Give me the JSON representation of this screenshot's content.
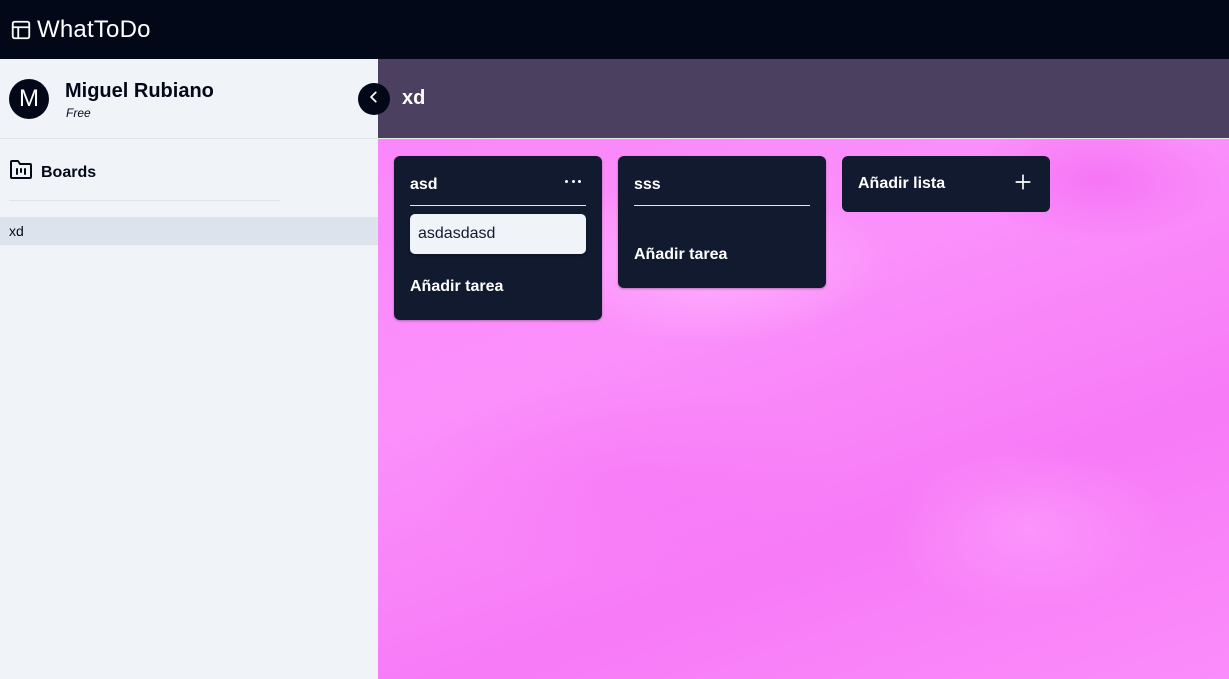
{
  "app": {
    "title": "WhatToDo",
    "logo_icon": "table-layout-icon"
  },
  "user": {
    "initial": "M",
    "name": "Miguel Rubiano",
    "plan": "Free"
  },
  "sidebar": {
    "boards_label": "Boards",
    "boards_icon": "folder-kanban-icon",
    "boards": [
      {
        "label": "xd",
        "selected": true
      }
    ]
  },
  "board": {
    "title": "xd",
    "header_color": "#4b4060",
    "background_color": "#fa85fa",
    "lists": [
      {
        "title": "asd",
        "has_menu": true,
        "tasks": [
          "asdasdasd"
        ],
        "add_task_label": "Añadir tarea"
      },
      {
        "title": "sss",
        "has_menu": false,
        "tasks": [],
        "add_task_label": "Añadir tarea"
      }
    ],
    "add_list_label": "Añadir lista"
  },
  "colors": {
    "topbar": "#020817",
    "list_card": "#111a2e",
    "sidebar": "#f0f4f9",
    "selected_board": "#dde3ec"
  }
}
